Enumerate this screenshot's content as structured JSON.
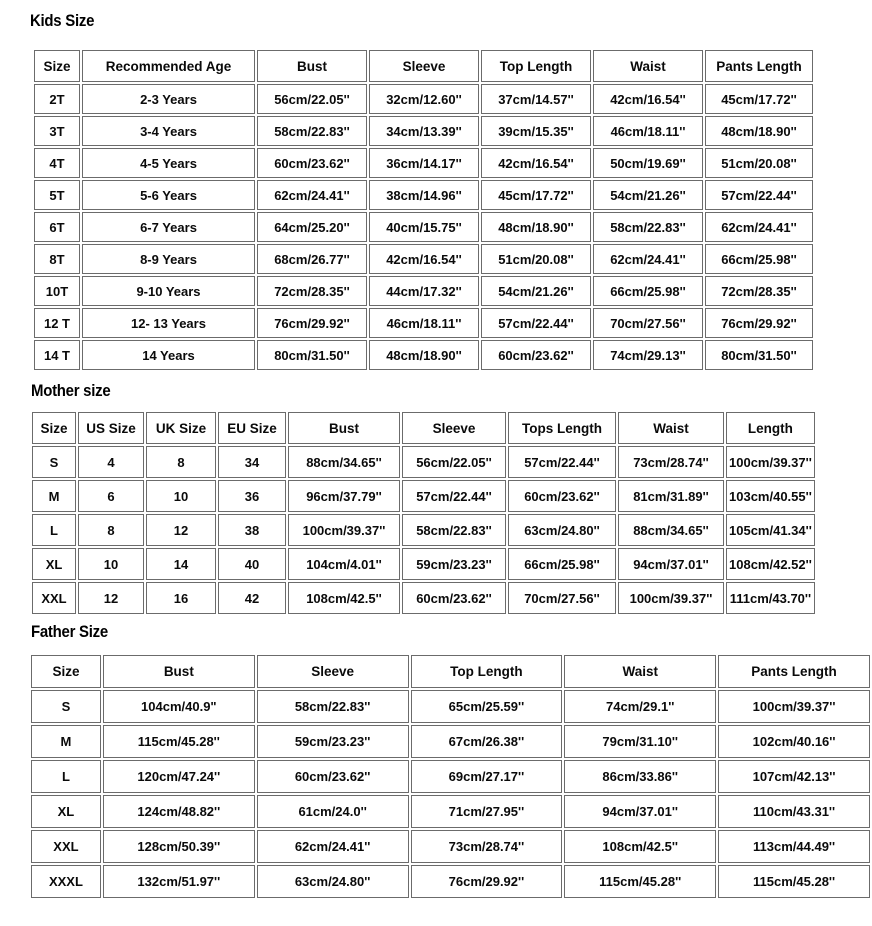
{
  "sections": [
    {
      "id": "kids",
      "title": "Kids Size",
      "columns": [
        "Size",
        "Recommended Age",
        "Bust",
        "Sleeve",
        "Top Length",
        "Waist",
        "Pants Length"
      ],
      "rows": [
        [
          "2T",
          "2-3 Years",
          "56cm/22.05''",
          "32cm/12.60''",
          "37cm/14.57''",
          "42cm/16.54''",
          "45cm/17.72''"
        ],
        [
          "3T",
          "3-4 Years",
          "58cm/22.83''",
          "34cm/13.39''",
          "39cm/15.35''",
          "46cm/18.11''",
          "48cm/18.90''"
        ],
        [
          "4T",
          "4-5 Years",
          "60cm/23.62''",
          "36cm/14.17''",
          "42cm/16.54''",
          "50cm/19.69''",
          "51cm/20.08''"
        ],
        [
          "5T",
          "5-6 Years",
          "62cm/24.41''",
          "38cm/14.96''",
          "45cm/17.72''",
          "54cm/21.26''",
          "57cm/22.44''"
        ],
        [
          "6T",
          "6-7 Years",
          "64cm/25.20''",
          "40cm/15.75''",
          "48cm/18.90''",
          "58cm/22.83''",
          "62cm/24.41''"
        ],
        [
          "8T",
          "8-9 Years",
          "68cm/26.77''",
          "42cm/16.54''",
          "51cm/20.08''",
          "62cm/24.41''",
          "66cm/25.98''"
        ],
        [
          "10T",
          "9-10 Years",
          "72cm/28.35''",
          "44cm/17.32''",
          "54cm/21.26''",
          "66cm/25.98''",
          "72cm/28.35''"
        ],
        [
          "12 T",
          "12- 13 Years",
          "76cm/29.92''",
          "46cm/18.11''",
          "57cm/22.44''",
          "70cm/27.56''",
          "76cm/29.92''"
        ],
        [
          "14 T",
          "14  Years",
          "80cm/31.50''",
          "48cm/18.90''",
          "60cm/23.62''",
          "74cm/29.13''",
          "80cm/31.50''"
        ]
      ]
    },
    {
      "id": "mother",
      "title": "Mother size",
      "columns": [
        "Size",
        "US Size",
        "UK Size",
        "EU Size",
        "Bust",
        "Sleeve",
        "Tops Length",
        "Waist",
        "Length"
      ],
      "rows": [
        [
          "S",
          "4",
          "8",
          "34",
          "88cm/34.65''",
          "56cm/22.05''",
          "57cm/22.44''",
          "73cm/28.74''",
          "100cm/39.37''"
        ],
        [
          "M",
          "6",
          "10",
          "36",
          "96cm/37.79''",
          "57cm/22.44''",
          "60cm/23.62''",
          "81cm/31.89''",
          "103cm/40.55''"
        ],
        [
          "L",
          "8",
          "12",
          "38",
          "100cm/39.37''",
          "58cm/22.83''",
          "63cm/24.80''",
          "88cm/34.65''",
          "105cm/41.34''"
        ],
        [
          "XL",
          "10",
          "14",
          "40",
          "104cm/4.01''",
          "59cm/23.23''",
          "66cm/25.98''",
          "94cm/37.01''",
          "108cm/42.52''"
        ],
        [
          "XXL",
          "12",
          "16",
          "42",
          "108cm/42.5''",
          "60cm/23.62''",
          "70cm/27.56''",
          "100cm/39.37''",
          "111cm/43.70''"
        ]
      ]
    },
    {
      "id": "father",
      "title": "Father Size",
      "columns": [
        "Size",
        "Bust",
        "Sleeve",
        "Top Length",
        "Waist",
        "Pants Length"
      ],
      "rows": [
        [
          "S",
          "104cm/40.9\"",
          "58cm/22.83''",
          "65cm/25.59''",
          "74cm/29.1''",
          "100cm/39.37''"
        ],
        [
          "M",
          "115cm/45.28''",
          "59cm/23.23''",
          "67cm/26.38''",
          "79cm/31.10''",
          "102cm/40.16''"
        ],
        [
          "L",
          "120cm/47.24''",
          "60cm/23.62''",
          "69cm/27.17''",
          "86cm/33.86''",
          "107cm/42.13''"
        ],
        [
          "XL",
          "124cm/48.82''",
          "61cm/24.0''",
          "71cm/27.95''",
          "94cm/37.01''",
          "110cm/43.31''"
        ],
        [
          "XXL",
          "128cm/50.39''",
          "62cm/24.41''",
          "73cm/28.74''",
          "108cm/42.5''",
          "113cm/44.49''"
        ],
        [
          "XXXL",
          "132cm/51.97''",
          "63cm/24.80''",
          "76cm/29.92''",
          "115cm/45.28''",
          "115cm/45.28''"
        ]
      ]
    }
  ],
  "colors": {
    "background": "#ffffff",
    "text": "#000000",
    "cell_border": "#6b6b6b"
  }
}
